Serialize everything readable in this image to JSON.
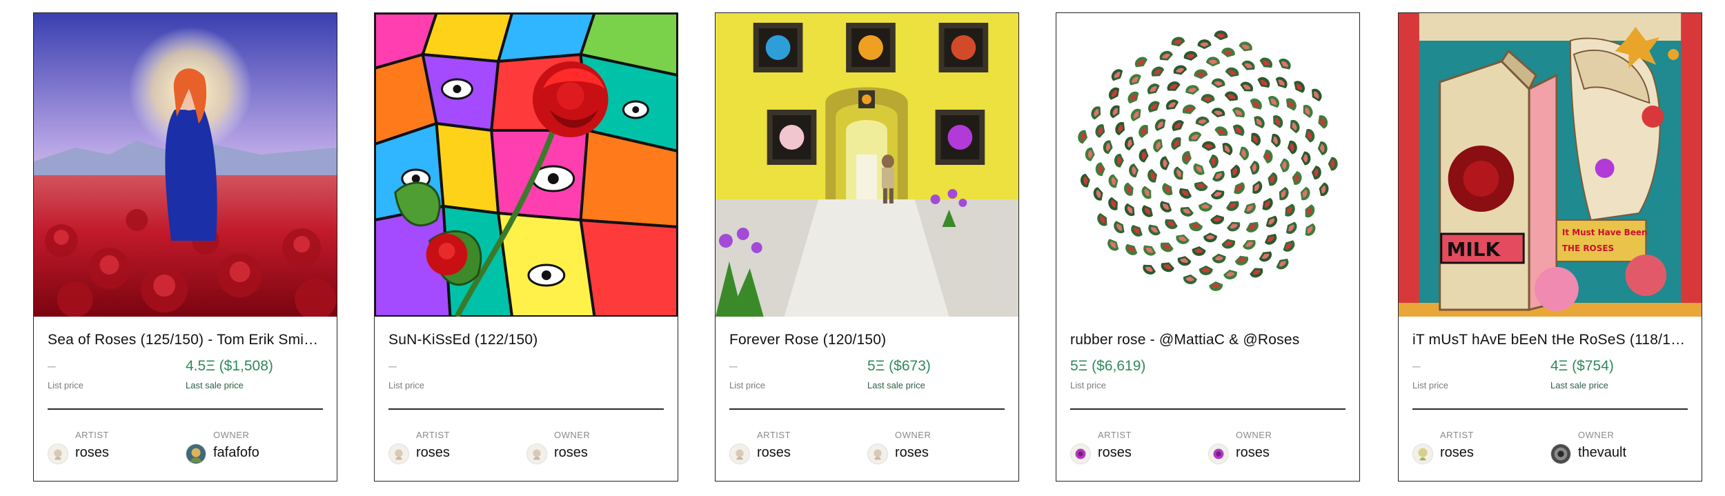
{
  "labels": {
    "list_price": "List price",
    "last_sale_price": "Last sale price",
    "artist": "ARTIST",
    "owner": "OWNER"
  },
  "cards": [
    {
      "title": "Sea of Roses (125/150) - Tom Erik Smi…",
      "left_value": "–",
      "left_label": "List price",
      "right_value": "4.5Ξ ($1,508)",
      "right_label": "Last sale price",
      "artist": "roses",
      "owner": "fafafofo",
      "artwork_icon": "woman-in-rose-field-image"
    },
    {
      "title": "SuN-KiSsEd (122/150)",
      "left_value": "–",
      "left_label": "List price",
      "right_value": "",
      "right_label": "",
      "artist": "roses",
      "owner": "roses",
      "artwork_icon": "psychedelic-rose-image"
    },
    {
      "title": "Forever Rose (120/150)",
      "left_value": "–",
      "left_label": "List price",
      "right_value": "5Ξ ($673)",
      "right_label": "Last sale price",
      "artist": "roses",
      "owner": "roses",
      "artwork_icon": "yellow-gallery-hallway-image"
    },
    {
      "title": "rubber rose - @MattiaC & @Roses",
      "left_value": "5Ξ ($6,619)",
      "left_label": "List price",
      "right_value": "",
      "right_label": "",
      "artist": "roses",
      "owner": "roses",
      "artwork_icon": "rubber-rose-circle-image"
    },
    {
      "title": "iT mUsT hAvE bEeN tHe RoSeS (118/1…",
      "left_value": "–",
      "left_label": "List price",
      "right_value": "4Ξ ($754)",
      "right_label": "Last sale price",
      "artist": "roses",
      "owner": "thevault",
      "artwork_icon": "milk-carton-collage-image"
    }
  ]
}
